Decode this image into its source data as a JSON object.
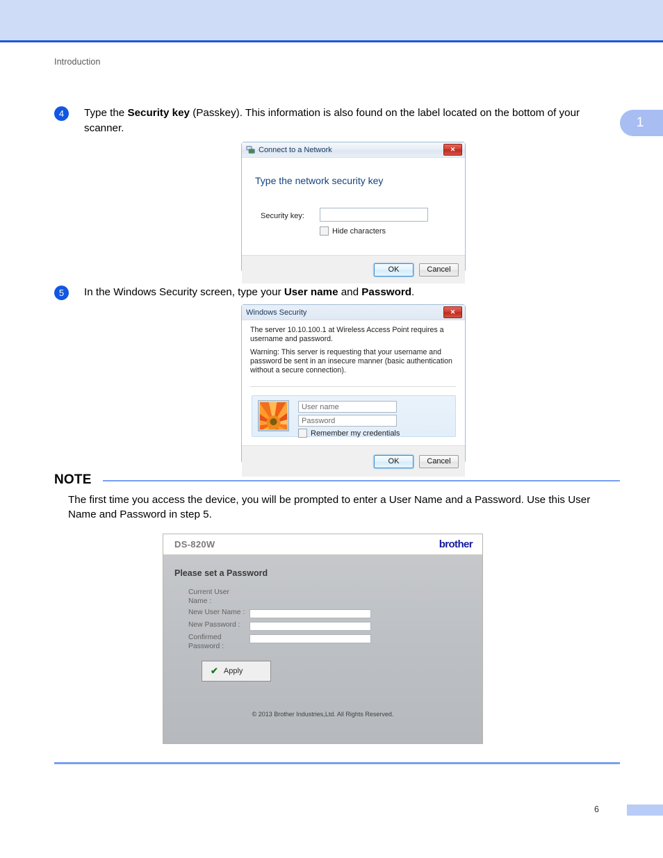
{
  "page": {
    "running_header": "Introduction",
    "chapter_tab": "1",
    "page_number": "6",
    "accent_blue": "#789ef4",
    "band_blue": "#cfdcf8",
    "bullet_blue": "#1157e2"
  },
  "steps": [
    {
      "number": "4",
      "text_before": "Type the ",
      "bold1": "Security key",
      "text_middle": " (Passkey). This information is also found on the label located on the bottom of your scanner.",
      "bold2": "",
      "text_after": ""
    },
    {
      "number": "5",
      "text_before": "In the Windows Security screen, type your ",
      "bold1": "User name",
      "text_middle": " and ",
      "bold2": "Password",
      "text_after": "."
    }
  ],
  "dialog_network": {
    "title": "Connect to a Network",
    "title_icon": "network-connect-icon",
    "close_glyph": "✕",
    "heading": "Type the network security key",
    "security_key_label": "Security key:",
    "security_key_value": "",
    "hide_characters_label": "Hide characters",
    "ok_label": "OK",
    "cancel_label": "Cancel"
  },
  "dialog_security": {
    "title": "Windows Security",
    "close_glyph": "✕",
    "message1": "The server 10.10.100.1 at Wireless Access Point requires a username and password.",
    "message2": "Warning: This server is requesting that your username and password be sent in an insecure manner (basic authentication without a secure connection).",
    "avatar_icon": "user-flower-avatar-icon",
    "username_placeholder": "User name",
    "username_value": "",
    "password_placeholder": "Password",
    "password_value": "",
    "remember_label": "Remember my credentials",
    "ok_label": "OK",
    "cancel_label": "Cancel"
  },
  "note": {
    "heading": "NOTE",
    "body": "The first time you access the device, you will be prompted to enter a User Name and a Password. Use this User Name and Password in step 5."
  },
  "web_panel": {
    "model": "DS-820W",
    "logo": "brother",
    "title": "Please set a Password",
    "fields": [
      {
        "label": "Current User Name :",
        "value": "",
        "has_input": false
      },
      {
        "label": "New User Name :",
        "value": "",
        "has_input": true
      },
      {
        "label": "New Password :",
        "value": "",
        "has_input": true
      },
      {
        "label": "Confirmed Password :",
        "value": "",
        "has_input": true
      }
    ],
    "apply_label": "Apply",
    "apply_icon": "✔",
    "copyright": "© 2013 Brother Industries,Ltd. All Rights Reserved."
  }
}
